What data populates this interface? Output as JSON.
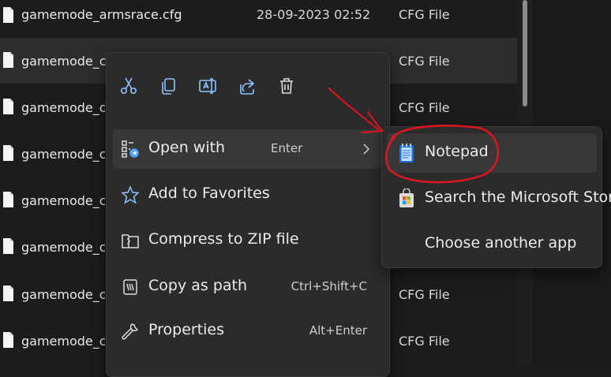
{
  "files": [
    {
      "name": "gamemode_armsrace.cfg",
      "date": "28-09-2023 02:52",
      "type": "CFG File"
    },
    {
      "name": "gamemode_casu",
      "date": "",
      "type": "CFG File"
    },
    {
      "name": "gamemode_com",
      "date": "",
      "type": "CFG File"
    },
    {
      "name": "gamemode_com",
      "date": "",
      "type": ""
    },
    {
      "name": "gamemode_com",
      "date": "",
      "type": ""
    },
    {
      "name": "gamemode_com",
      "date": "",
      "type": ""
    },
    {
      "name": "gamemode_com",
      "date": "",
      "type": "CFG File"
    },
    {
      "name": "gamemode_com",
      "date": "",
      "type": "CFG File"
    }
  ],
  "context_menu": {
    "quick_actions": [
      "cut-icon",
      "copy-icon",
      "rename-icon",
      "share-icon",
      "delete-icon"
    ],
    "items": [
      {
        "label": "Open with",
        "shortcut": "Enter",
        "icon": "open-with-icon"
      },
      {
        "label": "Add to Favorites",
        "shortcut": "",
        "icon": "star-icon"
      },
      {
        "label": "Compress to ZIP file",
        "shortcut": "",
        "icon": "zip-icon"
      },
      {
        "label": "Copy as path",
        "shortcut": "Ctrl+Shift+C",
        "icon": "copy-path-icon"
      },
      {
        "label": "Properties",
        "shortcut": "Alt+Enter",
        "icon": "wrench-icon"
      }
    ]
  },
  "submenu": {
    "items": [
      {
        "label": "Notepad",
        "icon": "notepad-icon"
      },
      {
        "label": "Search the Microsoft Store",
        "icon": "store-icon"
      },
      {
        "label": "Choose another app",
        "icon": ""
      }
    ]
  },
  "colors": {
    "background": "#1c1c1c",
    "menu": "#2b2b2b",
    "hover": "#383838",
    "annotation": "#e0141e",
    "accent_blue": "#4ea4ff"
  }
}
